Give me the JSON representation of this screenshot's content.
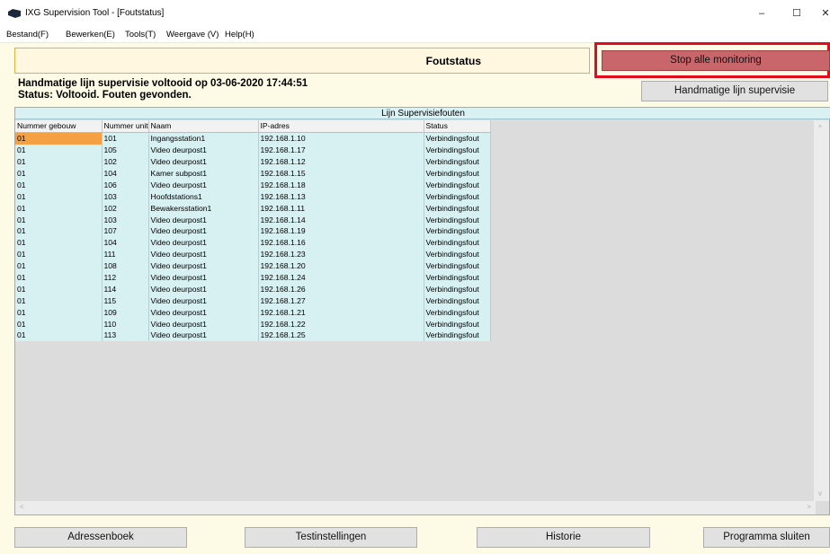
{
  "window": {
    "title": "IXG Supervision Tool - [Foutstatus]",
    "minimize": "–",
    "maximize": "☐",
    "close": "✕"
  },
  "menu": {
    "items": [
      "Bestand(F)",
      "Bewerken(E)",
      "Tools(T)",
      "Weergave (V)",
      "Help(H)"
    ]
  },
  "header": {
    "title": "Foutstatus"
  },
  "buttons": {
    "stop_monitoring": "Stop alle monitoring",
    "manual_supervision": "Handmatige lijn supervisie",
    "address_book": "Adressenboek",
    "test_settings": "Testinstellingen",
    "history": "Historie",
    "close_program": "Programma sluiten"
  },
  "status": {
    "line1": "Handmatige lijn supervisie voltooid op 03-06-2020 17:44:51",
    "line2": "Status: Voltooid. Fouten gevonden."
  },
  "grid": {
    "caption": "Lijn Supervisiefouten",
    "columns": [
      "Nummer gebouw",
      "Nummer unit",
      "Naam",
      "IP-adres",
      "Status"
    ],
    "rows": [
      [
        "01",
        "101",
        "Ingangsstation1",
        "192.168.1.10",
        "Verbindingsfout"
      ],
      [
        "01",
        "105",
        "Video deurpost1",
        "192.168.1.17",
        "Verbindingsfout"
      ],
      [
        "01",
        "102",
        "Video deurpost1",
        "192.168.1.12",
        "Verbindingsfout"
      ],
      [
        "01",
        "104",
        "Kamer subpost1",
        "192.168.1.15",
        "Verbindingsfout"
      ],
      [
        "01",
        "106",
        "Video deurpost1",
        "192.168.1.18",
        "Verbindingsfout"
      ],
      [
        "01",
        "103",
        "Hoofdstations1",
        "192.168.1.13",
        "Verbindingsfout"
      ],
      [
        "01",
        "102",
        "Bewakersstation1",
        "192.168.1.11",
        "Verbindingsfout"
      ],
      [
        "01",
        "103",
        "Video deurpost1",
        "192.168.1.14",
        "Verbindingsfout"
      ],
      [
        "01",
        "107",
        "Video deurpost1",
        "192.168.1.19",
        "Verbindingsfout"
      ],
      [
        "01",
        "104",
        "Video deurpost1",
        "192.168.1.16",
        "Verbindingsfout"
      ],
      [
        "01",
        "111",
        "Video deurpost1",
        "192.168.1.23",
        "Verbindingsfout"
      ],
      [
        "01",
        "108",
        "Video deurpost1",
        "192.168.1.20",
        "Verbindingsfout"
      ],
      [
        "01",
        "112",
        "Video deurpost1",
        "192.168.1.24",
        "Verbindingsfout"
      ],
      [
        "01",
        "114",
        "Video deurpost1",
        "192.168.1.26",
        "Verbindingsfout"
      ],
      [
        "01",
        "115",
        "Video deurpost1",
        "192.168.1.27",
        "Verbindingsfout"
      ],
      [
        "01",
        "109",
        "Video deurpost1",
        "192.168.1.21",
        "Verbindingsfout"
      ],
      [
        "01",
        "110",
        "Video deurpost1",
        "192.168.1.22",
        "Verbindingsfout"
      ],
      [
        "01",
        "113",
        "Video deurpost1",
        "192.168.1.25",
        "Verbindingsfout"
      ]
    ]
  },
  "colors": {
    "background": "#fdfbe6",
    "stop_button": "#c9666b",
    "highlight_border": "#e5091c",
    "row_background": "#d7f0f2",
    "selected_cell": "#f5a042"
  }
}
